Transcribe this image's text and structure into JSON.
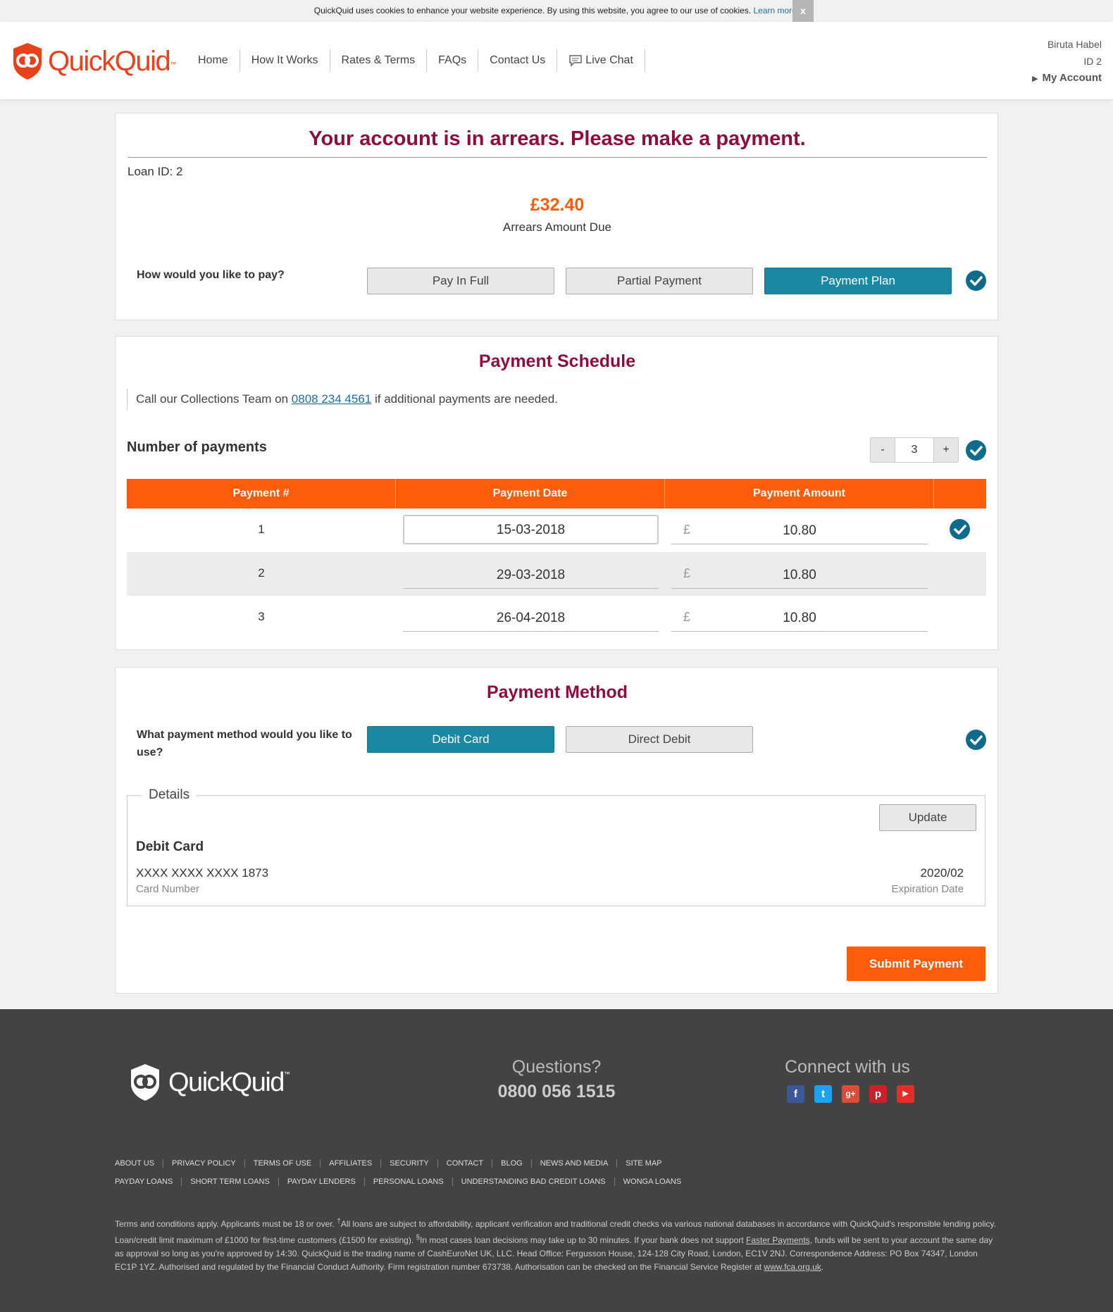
{
  "cookie": {
    "text": "QuickQuid uses cookies to enhance your website experience. By using this website, you agree to our use of cookies.",
    "link": "Learn more.",
    "close": "x"
  },
  "header": {
    "brand": "QuickQuid",
    "tm": "™",
    "nav": [
      "Home",
      "How It Works",
      "Rates & Terms",
      "FAQs",
      "Contact Us",
      "Live Chat"
    ],
    "user_name": "Biruta Habel",
    "user_id": "ID 2",
    "my_account": "My Account"
  },
  "arrears": {
    "title": "Your account is in arrears. Please make a payment.",
    "loan_id": "Loan ID: 2",
    "amount": "£32.40",
    "amount_label": "Arrears Amount Due",
    "question": "How would you like to pay?",
    "options": [
      "Pay In Full",
      "Partial Payment",
      "Payment Plan"
    ],
    "selected": "Payment Plan"
  },
  "schedule": {
    "title": "Payment Schedule",
    "note_before": "Call our Collections Team on ",
    "phone": "0808 234 4561",
    "note_after": " if additional payments are needed.",
    "num_label": "Number of payments",
    "minus": "-",
    "count": "3",
    "plus": "+",
    "headers": [
      "Payment #",
      "Payment Date",
      "Payment Amount"
    ],
    "currency": "£",
    "rows": [
      {
        "num": "1",
        "date": "15-03-2018",
        "amount": "10.80"
      },
      {
        "num": "2",
        "date": "29-03-2018",
        "amount": "10.80"
      },
      {
        "num": "3",
        "date": "26-04-2018",
        "amount": "10.80"
      }
    ]
  },
  "method": {
    "title": "Payment Method",
    "question": "What payment method would you like to use?",
    "options": [
      "Debit Card",
      "Direct Debit"
    ],
    "selected": "Debit Card",
    "details_legend": "Details",
    "update": "Update",
    "card_type": "Debit Card",
    "card_number": "XXXX XXXX XXXX 1873",
    "card_number_label": "Card Number",
    "expiry": "2020/02",
    "expiry_label": "Expiration Date",
    "submit": "Submit Payment"
  },
  "footer": {
    "brand": "QuickQuid",
    "tm": "™",
    "questions": "Questions?",
    "phone": "0800 056 1515",
    "connect": "Connect with us",
    "social": [
      "facebook-icon",
      "twitter-icon",
      "google-plus-icon",
      "pinterest-icon",
      "youtube-icon"
    ],
    "links_row1": [
      "About Us",
      "Privacy Policy",
      "Terms of Use",
      "Affiliates",
      "Security",
      "Contact",
      "Blog",
      "News and Media",
      "Site Map"
    ],
    "links_row2": [
      "Payday Loans",
      "Short Term Loans",
      "Payday Lenders",
      "Personal Loans",
      "Understanding Bad Credit Loans",
      "Wonga Loans"
    ],
    "legal_1": "Terms and conditions apply. Applicants must be 18 or over. ",
    "legal_dagger": "†",
    "legal_2": "All loans are subject to affordability, applicant verification and traditional credit checks via various national databases in accordance with QuickQuid's responsible lending policy. Loan/credit limit maximum of £1000 for first-time customers (£1500 for existing). ",
    "legal_section": "§",
    "legal_3": "In most cases loan decisions may take up to 30 minutes. If your bank does not support ",
    "legal_link1": "Faster Payments",
    "legal_4": ", funds will be sent to your account the same day as approval so long as you're approved by 14:30. QuickQuid is the trading name of CashEuroNet UK, LLC. Head Office: Fergusson House, 124-128 City Road, London, EC1V 2NJ. Correspondence Address: PO Box 74347, London EC1P 1YZ. Authorised and regulated by the Financial Conduct Authority. Firm registration number 673738. Authorisation can be checked on the Financial Service Register at ",
    "legal_link2": "www.fca.org.uk",
    "legal_5": "."
  },
  "colors": {
    "accent_orange": "#ff5c0a",
    "title_red": "#8e0d3e",
    "teal": "#1a88a3",
    "check_blue": "#0f6b8c",
    "footer_bg": "#434343"
  }
}
